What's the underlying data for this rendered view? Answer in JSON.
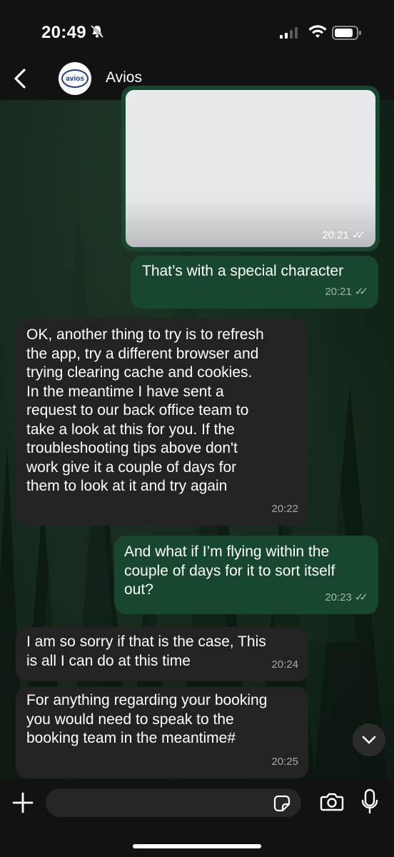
{
  "status_bar": {
    "time": "20:49"
  },
  "header": {
    "contact_name": "Avios",
    "avatar_text": "avios"
  },
  "messages": [
    {
      "direction": "out",
      "type": "image",
      "time": "20:21"
    },
    {
      "direction": "out",
      "text": "That’s with a special character",
      "time": "20:21"
    },
    {
      "direction": "in",
      "text": "OK,  another thing to try is to refresh\nthe app, try a different browser and\ntrying clearing cache and cookies.\nIn the meantime I have sent a\nrequest to our back office team to\ntake a look at this for you.  If the\ntroubleshooting tips above don't\nwork give it a couple of days for\nthem to look at it and try again",
      "time": "20:22"
    },
    {
      "direction": "out",
      "text": "And what if I’m flying within the\ncouple of days for it to sort itself\nout?",
      "time": "20:23"
    },
    {
      "direction": "in",
      "text": "I am so sorry if that is the case,  This\nis all I can do at this time",
      "time": "20:24"
    },
    {
      "direction": "in",
      "text": "For anything regarding your booking\nyou would need to speak to the\nbooking team in the meantime#",
      "time": "20:25"
    }
  ],
  "input": {
    "placeholder": ""
  },
  "icons": {
    "bell": "bell-slash-icon",
    "signal": "cellular-signal-icon",
    "wifi": "wifi-icon",
    "battery": "battery-icon",
    "back": "chevron-left-icon",
    "scroll_down": "chevron-down-icon",
    "plus": "plus-icon",
    "sticker": "sticker-icon",
    "camera": "camera-icon",
    "mic": "microphone-icon"
  },
  "colors": {
    "outgoing_bubble": "#17472f",
    "incoming_bubble": "#232323",
    "bar_background": "#121212"
  }
}
